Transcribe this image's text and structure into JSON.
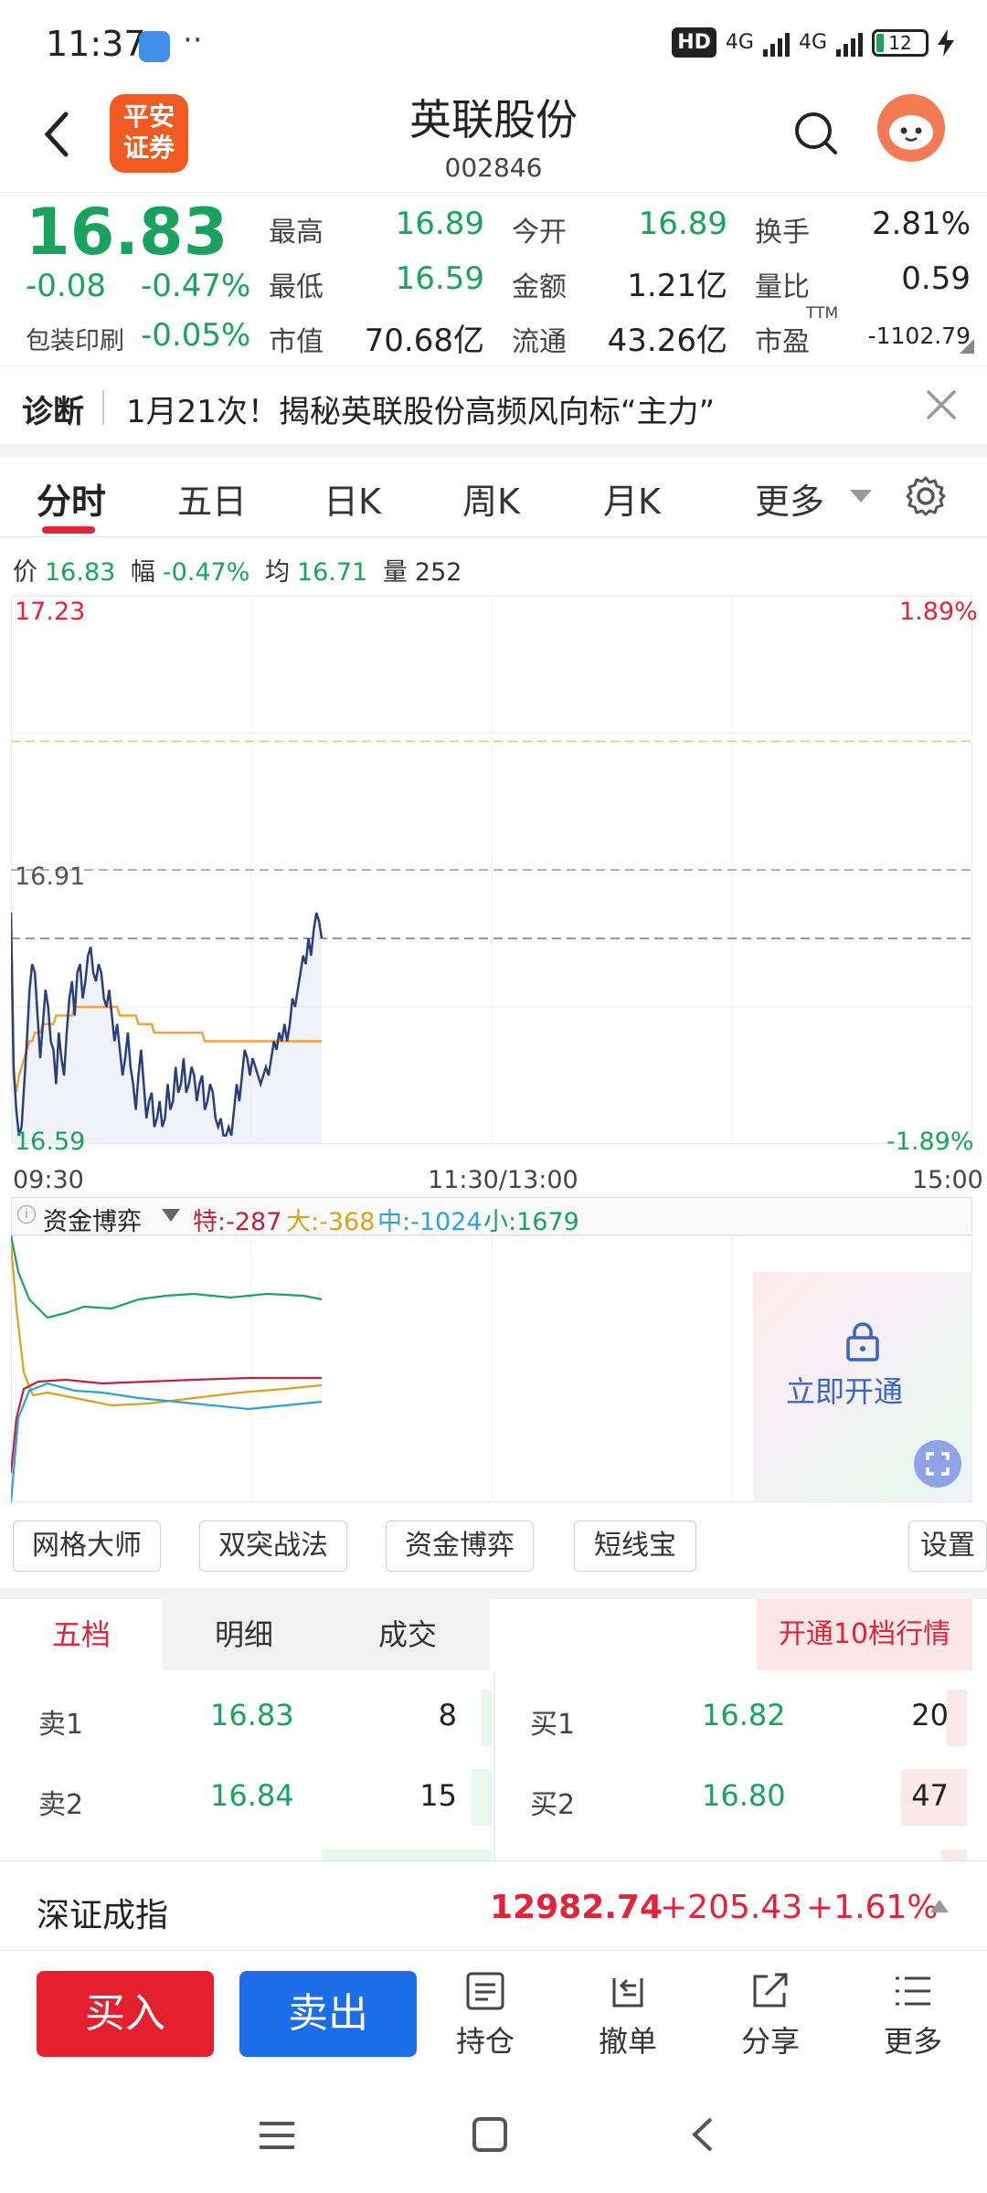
{
  "status": {
    "time": "11:37",
    "dots": "··",
    "hd": "HD",
    "net1": "4G",
    "net2": "4G",
    "battery": "12"
  },
  "header": {
    "logo_line1": "平安",
    "logo_line2": "证券",
    "stock_name": "英联股份",
    "stock_code": "002846"
  },
  "quote": {
    "price": "16.83",
    "change": "-0.08",
    "change_pct": "-0.47%",
    "sector": "包装印刷",
    "sector_pct": "-0.05%",
    "high_label": "最高",
    "high": "16.89",
    "low_label": "最低",
    "low": "16.59",
    "mktcap_label": "市值",
    "mktcap": "70.68亿",
    "open_label": "今开",
    "open": "16.89",
    "amount_label": "金额",
    "amount": "1.21亿",
    "float_label": "流通",
    "float": "43.26亿",
    "turnover_label": "换手",
    "turnover": "2.81%",
    "volratio_label": "量比",
    "volratio": "0.59",
    "pe_label": "市盈",
    "pe_sup": "TTM",
    "pe": "-1102.79"
  },
  "diagnosis": {
    "label": "诊断",
    "text": "1月21次！揭秘英联股份高频风向标“主力”"
  },
  "tabs": [
    "分时",
    "五日",
    "日K",
    "周K",
    "月K",
    "更多"
  ],
  "infoline": {
    "price_label": "价",
    "price": "16.83",
    "amp_label": "幅",
    "amp": "-0.47%",
    "avg_label": "均",
    "avg": "16.71",
    "vol_label": "量",
    "vol": "252"
  },
  "chart_data": {
    "type": "line",
    "title": "",
    "y_top": "17.23",
    "y_mid": "16.91",
    "y_bottom": "16.59",
    "pct_top": "1.89%",
    "pct_bottom": "-1.89%",
    "x_start": "09:30",
    "x_mid": "11:30/13:00",
    "x_end": "15:00",
    "ylim": [
      16.59,
      17.23
    ],
    "prev_close": 16.91,
    "series": [
      {
        "name": "价",
        "color": "#2b3f7e",
        "values": [
          16.86,
          16.68,
          16.63,
          16.6,
          16.61,
          16.66,
          16.71,
          16.77,
          16.8,
          16.79,
          16.74,
          16.69,
          16.73,
          16.77,
          16.75,
          16.71,
          16.7,
          16.66,
          16.72,
          16.69,
          16.67,
          16.72,
          16.76,
          16.78,
          16.74,
          16.79,
          16.8,
          16.76,
          16.78,
          16.81,
          16.82,
          16.79,
          16.78,
          16.8,
          16.79,
          16.76,
          16.75,
          16.77,
          16.74,
          16.71,
          16.73,
          16.7,
          16.67,
          16.69,
          16.72,
          16.68,
          16.66,
          16.63,
          16.67,
          16.7,
          16.66,
          16.62,
          16.64,
          16.65,
          16.61,
          16.62,
          16.64,
          16.61,
          16.62,
          16.66,
          16.63,
          16.64,
          16.68,
          16.65,
          16.66,
          16.69,
          16.65,
          16.66,
          16.68,
          16.67,
          16.64,
          16.66,
          16.67,
          16.63,
          16.64,
          16.66,
          16.65,
          16.62,
          16.61,
          16.62,
          16.6,
          16.6,
          16.61,
          16.6,
          16.63,
          16.66,
          16.64,
          16.67,
          16.7,
          16.69,
          16.67,
          16.69,
          16.68,
          16.67,
          16.66,
          16.67,
          16.68,
          16.67,
          16.69,
          16.71,
          16.7,
          16.72,
          16.71,
          16.73,
          16.71,
          16.73,
          16.76,
          16.75,
          16.77,
          16.79,
          16.81,
          16.8,
          16.83,
          16.81,
          16.84,
          16.86,
          16.85,
          16.83
        ]
      },
      {
        "name": "均",
        "color": "#f2a23c",
        "values": [
          16.86,
          16.67,
          16.65,
          16.67,
          16.68,
          16.69,
          16.7,
          16.71,
          16.71,
          16.72,
          16.72,
          16.72,
          16.73,
          16.73,
          16.73,
          16.73,
          16.73,
          16.74,
          16.74,
          16.74,
          16.74,
          16.74,
          16.74,
          16.74,
          16.75,
          16.75,
          16.75,
          16.75,
          16.75,
          16.75,
          16.75,
          16.75,
          16.75,
          16.75,
          16.75,
          16.75,
          16.75,
          16.75,
          16.75,
          16.75,
          16.75,
          16.74,
          16.74,
          16.74,
          16.74,
          16.74,
          16.74,
          16.74,
          16.73,
          16.73,
          16.73,
          16.73,
          16.73,
          16.73,
          16.72,
          16.72,
          16.72,
          16.72,
          16.72,
          16.72,
          16.72,
          16.72,
          16.72,
          16.72,
          16.72,
          16.72,
          16.72,
          16.72,
          16.72,
          16.72,
          16.72,
          16.72,
          16.72,
          16.71,
          16.71,
          16.71,
          16.71,
          16.71,
          16.71,
          16.71,
          16.71,
          16.71,
          16.71,
          16.71,
          16.71,
          16.71,
          16.71,
          16.71,
          16.71,
          16.71,
          16.71,
          16.71,
          16.71,
          16.71,
          16.71,
          16.71,
          16.71,
          16.71,
          16.71,
          16.71,
          16.71,
          16.71,
          16.71,
          16.71,
          16.71,
          16.71,
          16.71,
          16.71,
          16.71,
          16.71,
          16.71,
          16.71,
          16.71,
          16.71,
          16.71,
          16.71,
          16.71,
          16.71
        ]
      }
    ]
  },
  "fundflow": {
    "selector": "资金博弈",
    "te_label": "特:",
    "te": "-287",
    "da_label": "大:",
    "da": "-368",
    "zhong_label": "中:",
    "zhong": "-1024",
    "xiao_label": "小:",
    "xiao": "1679",
    "unlock": "立即开通"
  },
  "strategies": [
    "网格大师",
    "双突战法",
    "资金博弈",
    "短线宝",
    "设置"
  ],
  "orderbook": {
    "tabs": [
      "五档",
      "明细",
      "成交"
    ],
    "open_label": "开通10档行情",
    "sell": [
      {
        "label": "卖1",
        "price": "16.83",
        "vol": "8"
      },
      {
        "label": "卖2",
        "price": "16.84",
        "vol": "15"
      }
    ],
    "buy": [
      {
        "label": "买1",
        "price": "16.82",
        "vol": "20"
      },
      {
        "label": "买2",
        "price": "16.80",
        "vol": "47"
      }
    ]
  },
  "ticker": {
    "name": "深证成指",
    "value": "12982.74",
    "change": "+205.43",
    "pct": "+1.61%"
  },
  "actions": {
    "buy": "买入",
    "sell": "卖出",
    "position": "持仓",
    "cancel": "撤单",
    "share": "分享",
    "more": "更多"
  }
}
